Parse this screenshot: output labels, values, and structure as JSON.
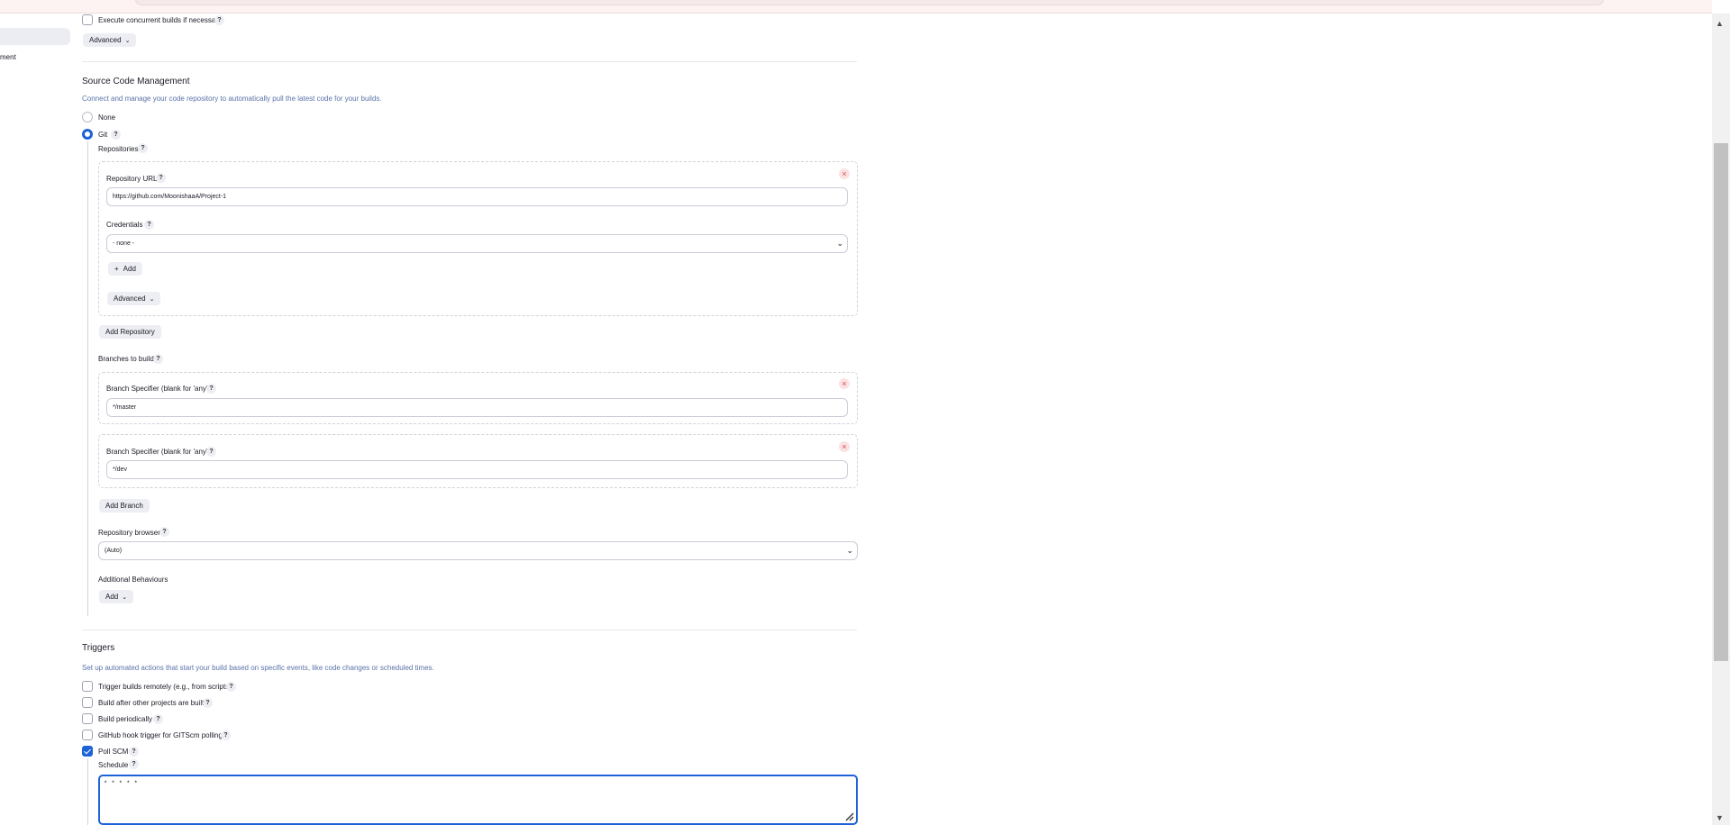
{
  "sidebar": {
    "partial_label": "ment"
  },
  "general": {
    "concurrent_label": "Execute concurrent builds if necessary",
    "advanced_label": "Advanced"
  },
  "scm": {
    "title": "Source Code Management",
    "description": "Connect and manage your code repository to automatically pull the latest code for your builds.",
    "options": {
      "none": "None",
      "git": "Git"
    },
    "selected": "Git",
    "repositories_label": "Repositories",
    "repo_url_label": "Repository URL",
    "repo_url_value": "https://github.com/MoonishaaA/Project-1",
    "credentials_label": "Credentials",
    "credentials_value": "- none -",
    "add_label": "Add",
    "repo_advanced_label": "Advanced",
    "add_repository_label": "Add Repository",
    "branches_label": "Branches to build",
    "branch_specifier_label": "Branch Specifier (blank for 'any')",
    "branches": [
      "*/master",
      "*/dev"
    ],
    "add_branch_label": "Add Branch",
    "repo_browser_label": "Repository browser",
    "repo_browser_value": "(Auto)",
    "additional_behaviours_label": "Additional Behaviours",
    "behaviours_add_label": "Add"
  },
  "triggers": {
    "title": "Triggers",
    "description": "Set up automated actions that start your build based on specific events, like code changes or scheduled times.",
    "items": [
      {
        "label": "Trigger builds remotely (e.g., from scripts)",
        "checked": false
      },
      {
        "label": "Build after other projects are built",
        "checked": false
      },
      {
        "label": "Build periodically",
        "checked": false
      },
      {
        "label": "GitHub hook trigger for GITScm polling",
        "checked": false
      },
      {
        "label": "Poll SCM",
        "checked": true
      }
    ],
    "schedule_label": "Schedule",
    "schedule_value": "* * * * *"
  },
  "icons": {
    "help": "?",
    "close": "×",
    "chevron": "⌄",
    "plus": "+"
  },
  "colors": {
    "accent": "#1d62d6",
    "description": "#5a72a8",
    "danger": "#e0444d"
  }
}
